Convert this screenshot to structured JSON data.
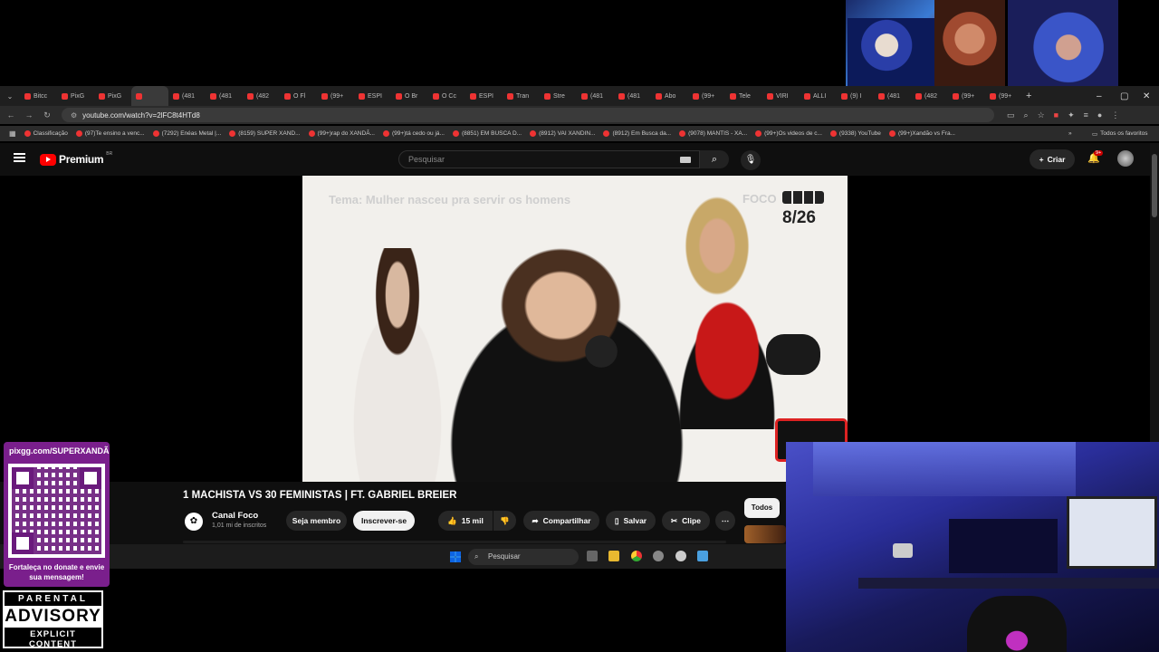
{
  "colors": {
    "yt_red": "#ff0000",
    "bg": "#0f0f0f",
    "pix_purple": "#7a1f8c"
  },
  "tabs": [
    "Bitcc",
    "PixG",
    "PixG",
    "",
    "(481",
    "(481",
    "(482",
    "O Fl",
    "(99+",
    "ESPI",
    "O Br",
    "O Cc",
    "ESPI",
    "Tran",
    "Stre",
    "(481",
    "(481",
    "Abo",
    "(99+",
    "Tele",
    "VIRI",
    "ALLI",
    "(9) I",
    "(481",
    "(482",
    "(99+",
    "(99+"
  ],
  "window_controls": {
    "minimize": "–",
    "maximize": "▢",
    "close": "✕",
    "new_tab": "+"
  },
  "address": {
    "url": "youtube.com/watch?v=2lFC8t4HTd8"
  },
  "bookmarks": [
    "Classificação",
    "(97)Te ensino a venc...",
    "(7292) Enéas Metal |...",
    "(8159) SUPER XAND...",
    "(99+)rap do XANDÃ...",
    "(99+)tá cedo ou já...",
    "(8851) EM BUSCA D...",
    "(8912) VAI XANDIN...",
    "(8912) Em Busca da...",
    "(9078) MANTIS - XA...",
    "(99+)Os videos de c...",
    "(9338) YouTube",
    "(99+)Xandão vs Fra..."
  ],
  "bookmarks_more": "»",
  "bookmarks_all": "Todos os favoritos",
  "yt": {
    "logo": "Premium",
    "logo_region": "BR",
    "search_placeholder": "Pesquisar",
    "create_label": "Criar",
    "notif_badge": "9+"
  },
  "video": {
    "overlay_topic": "Tema: Mulher nasceu pra servir os homens",
    "overlay_brand": "FOCO",
    "overlay_count": "8/26",
    "title": "1 MACHISTA VS 30 FEMINISTAS | FT. GABRIEL BREIER",
    "channel": "Canal Foco",
    "subscribers": "1,01 mi de inscritos",
    "join_label": "Seja membro",
    "subscribe_label": "Inscrever-se",
    "likes": "15 mil",
    "share_label": "Compartilhar",
    "save_label": "Salvar",
    "clip_label": "Clipe",
    "more_label": "⋯",
    "filter_all": "Todos"
  },
  "taskbar": {
    "search_label": "Pesquisar"
  },
  "pixgg": {
    "url": "pixgg.com/SUPERXANDÃ",
    "message": "Fortaleça no donate e envie sua mensagem!"
  },
  "advisory": {
    "top": "PARENTAL",
    "mid": "ADVISORY",
    "bot": "EXPLICIT CONTENT"
  }
}
